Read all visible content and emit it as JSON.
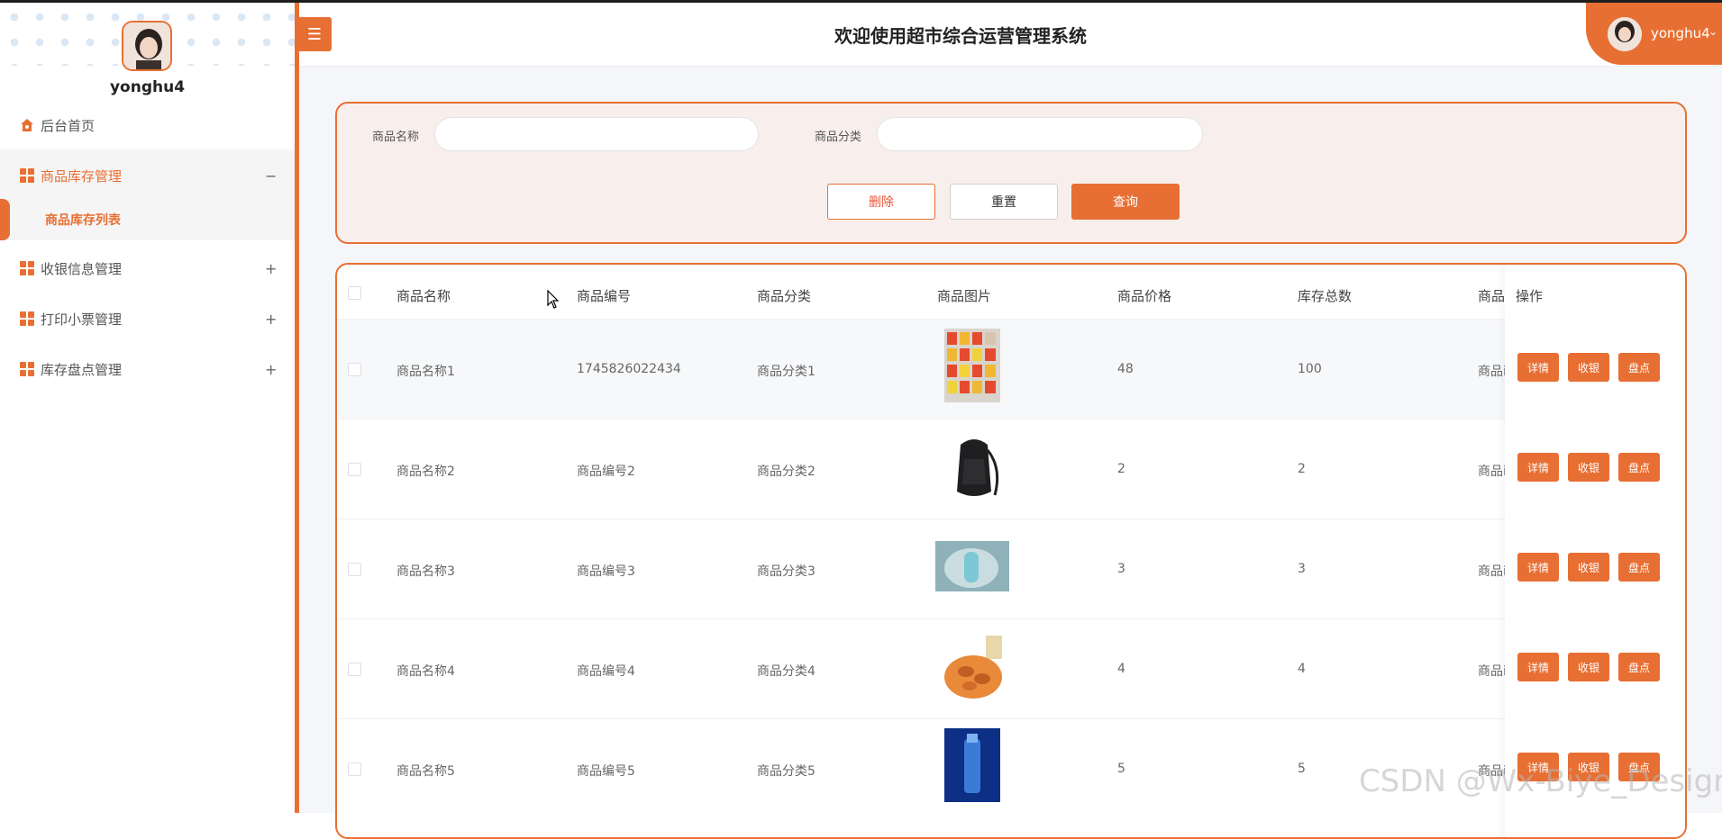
{
  "app": {
    "title": "欢迎使用超市综合运营管理系统",
    "accent": "#e86f33"
  },
  "sidebar": {
    "profile_name": "yonghu4",
    "items": [
      {
        "label": "后台首页",
        "icon": "home-icon"
      },
      {
        "label": "商品库存管理",
        "icon": "grid-icon",
        "toggle": "−",
        "active": true
      },
      {
        "label": "收银信息管理",
        "icon": "grid-icon",
        "toggle": "+"
      },
      {
        "label": "打印小票管理",
        "icon": "grid-icon",
        "toggle": "+"
      },
      {
        "label": "库存盘点管理",
        "icon": "grid-icon",
        "toggle": "+"
      }
    ],
    "submenu": {
      "label": "商品库存列表"
    }
  },
  "header": {
    "menu_toggle_icon": "☰",
    "user": {
      "name": "yonghu4",
      "caret": "⌄"
    }
  },
  "search": {
    "name_label": "商品名称",
    "name_value": "",
    "category_label": "商品分类",
    "category_value": "",
    "delete_label": "删除",
    "reset_label": "重置",
    "query_label": "查询"
  },
  "table": {
    "columns": [
      "商品名称",
      "商品编号",
      "商品分类",
      "商品图片",
      "商品价格",
      "库存总数",
      "商品",
      "操作"
    ],
    "rows": [
      {
        "name": "商品名称1",
        "code": "1745826022434",
        "category": "商品分类1",
        "image": "snack-shelf",
        "price": "48",
        "stock": "100",
        "extra": "商品i"
      },
      {
        "name": "商品名称2",
        "code": "商品编号2",
        "category": "商品分类2",
        "image": "backpack",
        "price": "2",
        "stock": "2",
        "extra": "商品i"
      },
      {
        "name": "商品名称3",
        "code": "商品编号3",
        "category": "商品分类3",
        "image": "bottle",
        "price": "3",
        "stock": "3",
        "extra": "商品i"
      },
      {
        "name": "商品名称4",
        "code": "商品编号4",
        "category": "商品分类4",
        "image": "almonds",
        "price": "4",
        "stock": "4",
        "extra": "商品i"
      },
      {
        "name": "商品名称5",
        "code": "商品编号5",
        "category": "商品分类5",
        "image": "blue-bottle",
        "price": "5",
        "stock": "5",
        "extra": "商品i"
      }
    ],
    "actions": {
      "detail": "详情",
      "cashier": "收银",
      "inventory": "盘点"
    }
  },
  "watermark": "CSDN @Wx-Biye_Design"
}
